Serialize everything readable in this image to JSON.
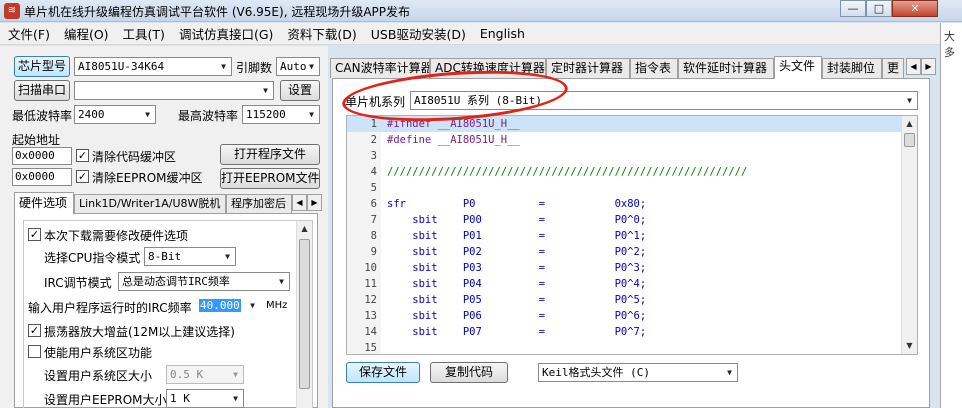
{
  "window": {
    "title": "单片机在线升级编程仿真调试平台软件 (V6.95E), 远程现场升级APP发布",
    "buttons": [
      "—",
      "□",
      "✕"
    ]
  },
  "menu": [
    "文件(F)",
    "编程(O)",
    "工具(T)",
    "调试仿真接口(G)",
    "资料下载(D)",
    "USB驱动安装(D)",
    "English"
  ],
  "side_text": "大多",
  "left": {
    "chip_button": "芯片型号",
    "chip_value": "AI8051U-34K64",
    "pin_label": "引脚数",
    "pin_value": "Auto",
    "scan_button": "扫描串口",
    "port_value": "",
    "settings_button": "设置",
    "min_baud_label": "最低波特率",
    "min_baud_value": "2400",
    "max_baud_label": "最高波特率",
    "max_baud_value": "115200",
    "start_addr_label": "起始地址",
    "addr1": "0x0000",
    "clear_code_label": "清除代码缓冲区",
    "open_prog_button": "打开程序文件",
    "addr2": "0x0000",
    "clear_eeprom_label": "清除EEPROM缓冲区",
    "open_eeprom_button": "打开EEPROM文件",
    "tabs": [
      "硬件选项",
      "Link1D/Writer1A/U8W脱机",
      "程序加密后"
    ],
    "hw": {
      "modify_hw_label": "本次下载需要修改硬件选项",
      "cpu_mode_label": "选择CPU指令模式",
      "cpu_mode_value": "8-Bit",
      "irc_mode_label": "IRC调节模式",
      "irc_mode_value": "总是动态调节IRC频率",
      "freq_label": "输入用户程序运行时的IRC频率",
      "freq_value": "40.000",
      "freq_unit": "MHz",
      "osc_gain_label": "振荡器放大增益(12M以上建议选择)",
      "user_sys_label": "使能用户系统区功能",
      "sys_size_label": "设置用户系统区大小",
      "sys_size_value": "0.5 K",
      "eeprom_size_label": "设置用户EEPROM大小",
      "eeprom_size_value": "1    K"
    }
  },
  "right": {
    "tabs": [
      "CAN波特率计算器",
      "ADC转换速度计算器",
      "定时器计算器",
      "指令表",
      "软件延时计算器",
      "头文件",
      "封装脚位",
      "更"
    ],
    "series_label": "单片机系列",
    "series_value": "AI8051U 系列 (8-Bit)",
    "code_lines": [
      {
        "n": "1",
        "t": "#ifndef __AI8051U_H__"
      },
      {
        "n": "2",
        "t": "#define __AI8051U_H__"
      },
      {
        "n": "3",
        "t": ""
      },
      {
        "n": "4",
        "t": "/////////////////////////////////////////////////////////"
      },
      {
        "n": "5",
        "t": ""
      },
      {
        "n": "6",
        "t": "sfr         P0          =           0x80;"
      },
      {
        "n": "7",
        "t": "    sbit    P00         =           P0^0;"
      },
      {
        "n": "8",
        "t": "    sbit    P01         =           P0^1;"
      },
      {
        "n": "9",
        "t": "    sbit    P02         =           P0^2;"
      },
      {
        "n": "10",
        "t": "    sbit    P03         =           P0^3;"
      },
      {
        "n": "11",
        "t": "    sbit    P04         =           P0^4;"
      },
      {
        "n": "12",
        "t": "    sbit    P05         =           P0^5;"
      },
      {
        "n": "13",
        "t": "    sbit    P06         =           P0^6;"
      },
      {
        "n": "14",
        "t": "    sbit    P07         =           P0^7;"
      },
      {
        "n": "15",
        "t": ""
      }
    ],
    "save_button": "保存文件",
    "copy_button": "复制代码",
    "format_value": "Keil格式头文件 (C)"
  },
  "colors": {
    "annotation": "#e0241a",
    "highlight": "#cde3f7",
    "freq_selected": "#3399ff"
  }
}
